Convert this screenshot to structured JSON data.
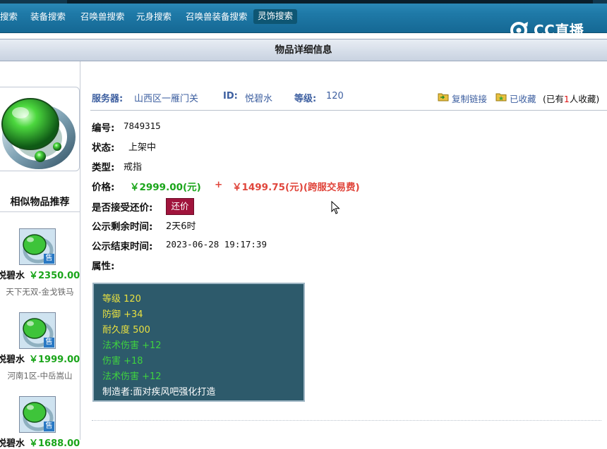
{
  "nav": {
    "items": [
      {
        "label": "搜索"
      },
      {
        "label": "装备搜索"
      },
      {
        "label": "召唤兽搜索"
      },
      {
        "label": "元身搜索"
      },
      {
        "label": "召唤兽装备搜索"
      },
      {
        "label": "灵饰搜索"
      }
    ],
    "logo": "CC直播"
  },
  "section_title": "物品详细信息",
  "header": {
    "server_label": "服务器:",
    "server_value": "山西区一雁门关",
    "id_label": "ID:",
    "id_value": "悦碧水",
    "level_label": "等级:",
    "level_value": "120",
    "copy_link": "复制链接",
    "favorited": "已收藏",
    "fav_prefix": "(已有",
    "fav_count": "1",
    "fav_suffix": "人收藏)"
  },
  "details": {
    "number_label": "编号:",
    "number_value": "7849315",
    "status_label": "状态:",
    "status_value": "上架中",
    "type_label": "类型:",
    "type_value": "戒指",
    "price_label": "价格:",
    "price_main": "￥2999.00(元)",
    "price_plus": "+",
    "price_fee": "￥1499.75(元)(跨服交易费)",
    "bargain_label": "是否接受还价:",
    "bargain_button": "还价",
    "remaining_label": "公示剩余时间:",
    "remaining_value": "2天6时",
    "end_label": "公示结束时间:",
    "end_value": "2023-06-28 19:17:39",
    "attr_label": "属性:"
  },
  "attributes": [
    {
      "text": "等级 120",
      "color": "#e8e040"
    },
    {
      "text": "防御 +34",
      "color": "#e8e040"
    },
    {
      "text": "耐久度 500",
      "color": "#e8e040"
    },
    {
      "text": "法术伤害 +12",
      "color": "#3fd23f"
    },
    {
      "text": "伤害 +18",
      "color": "#3fd23f"
    },
    {
      "text": "法术伤害 +12",
      "color": "#3fd23f"
    },
    {
      "text": "制造者:面对疾风吧强化打造",
      "color": "#ffffff"
    }
  ],
  "similar": {
    "title": "相似物品推荐",
    "badge": "售",
    "items": [
      {
        "name": "悦碧水",
        "price": "￥2350.00",
        "server": "天下无双-金戈铁马"
      },
      {
        "name": "悦碧水",
        "price": "￥1999.00",
        "server": "河南1区-中岳嵩山"
      },
      {
        "name": "悦碧水",
        "price": "￥1688.00",
        "server": ""
      }
    ]
  },
  "colors": {
    "nav_bg": "#1f7aa8",
    "price_green": "#1aa51a",
    "fee_red": "#e0463c",
    "bargain_bg": "#a0143c",
    "attr_bg": "#2d5a6b",
    "header_blue": "#3d5fa0"
  },
  "icons": {
    "copy": "folder-copy-icon",
    "favorite": "folder-star-icon",
    "item": "jade-ring-icon"
  }
}
